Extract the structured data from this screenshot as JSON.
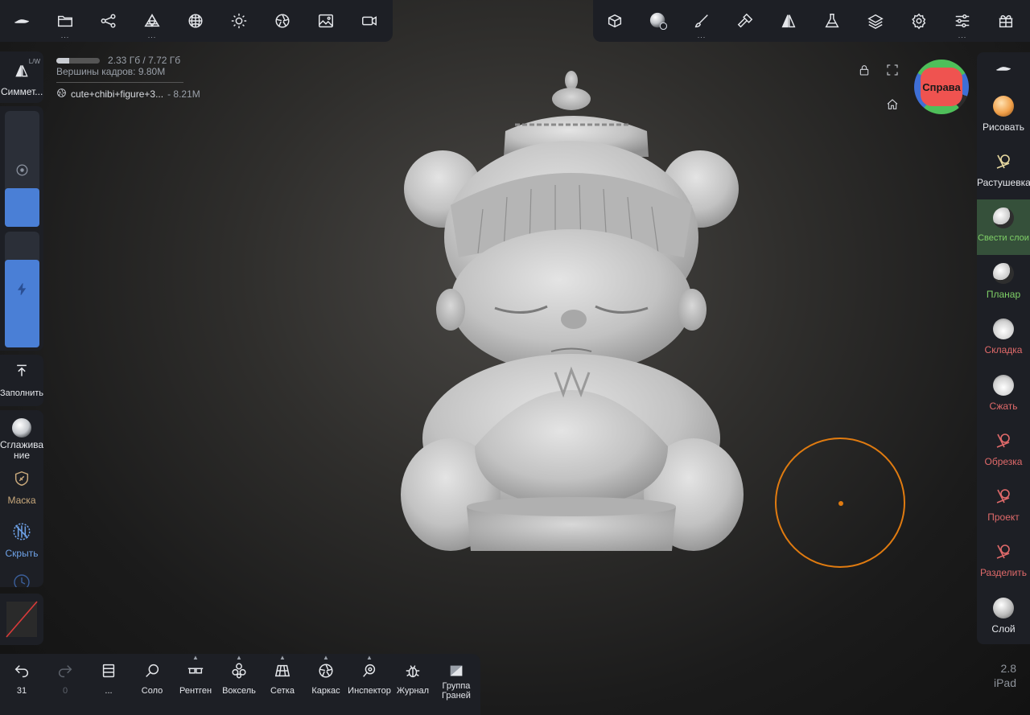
{
  "status": {
    "memory": "2.33 Гб / 7.72 Гб",
    "memory_fraction": 0.3,
    "vertices": "Вершины кадров:  9.80M",
    "mesh_name": "cute+chibi+figure+3...",
    "mesh_size": " - 8.21M"
  },
  "left": {
    "symmetry_label": "Симмет...",
    "symmetry_corner": "L/W",
    "fill_label": "Заполнить",
    "smooth_label": "Сглажива\nние",
    "mask_label": "Маска",
    "hide_label": "Скрыть",
    "radius_fraction": 0.33,
    "intensity_fraction": 0.76
  },
  "right_tools": [
    {
      "label": "Рисовать",
      "color": "#e6e8ec"
    },
    {
      "label": "Растушевка",
      "color": "#e6e8ec"
    },
    {
      "label": "Свести слои",
      "color": "#7fd067"
    },
    {
      "label": "Планар",
      "color": "#7fd067"
    },
    {
      "label": "Складка",
      "color": "#e06a6a"
    },
    {
      "label": "Сжать",
      "color": "#e06a6a"
    },
    {
      "label": "Обрезка",
      "color": "#e06a6a"
    },
    {
      "label": "Проект",
      "color": "#e06a6a"
    },
    {
      "label": "Разделить",
      "color": "#e06a6a"
    },
    {
      "label": "Слой",
      "color": "#e6e8ec"
    }
  ],
  "viewcube_label": "Справа",
  "bottom": {
    "undo_count": "31",
    "redo_count": "0",
    "more": "...",
    "solo": "Соло",
    "xray": "Рентген",
    "voxel": "Воксель",
    "grid": "Сетка",
    "wireframe": "Каркас",
    "inspector": "Инспектор",
    "journal": "Журнал",
    "facegroup": "Группа\nГраней"
  },
  "version": "2.8",
  "device": "iPad",
  "colors": {
    "accent": "#4a7fd6",
    "brush": "#e07b10",
    "panel": "#1d1f25"
  }
}
